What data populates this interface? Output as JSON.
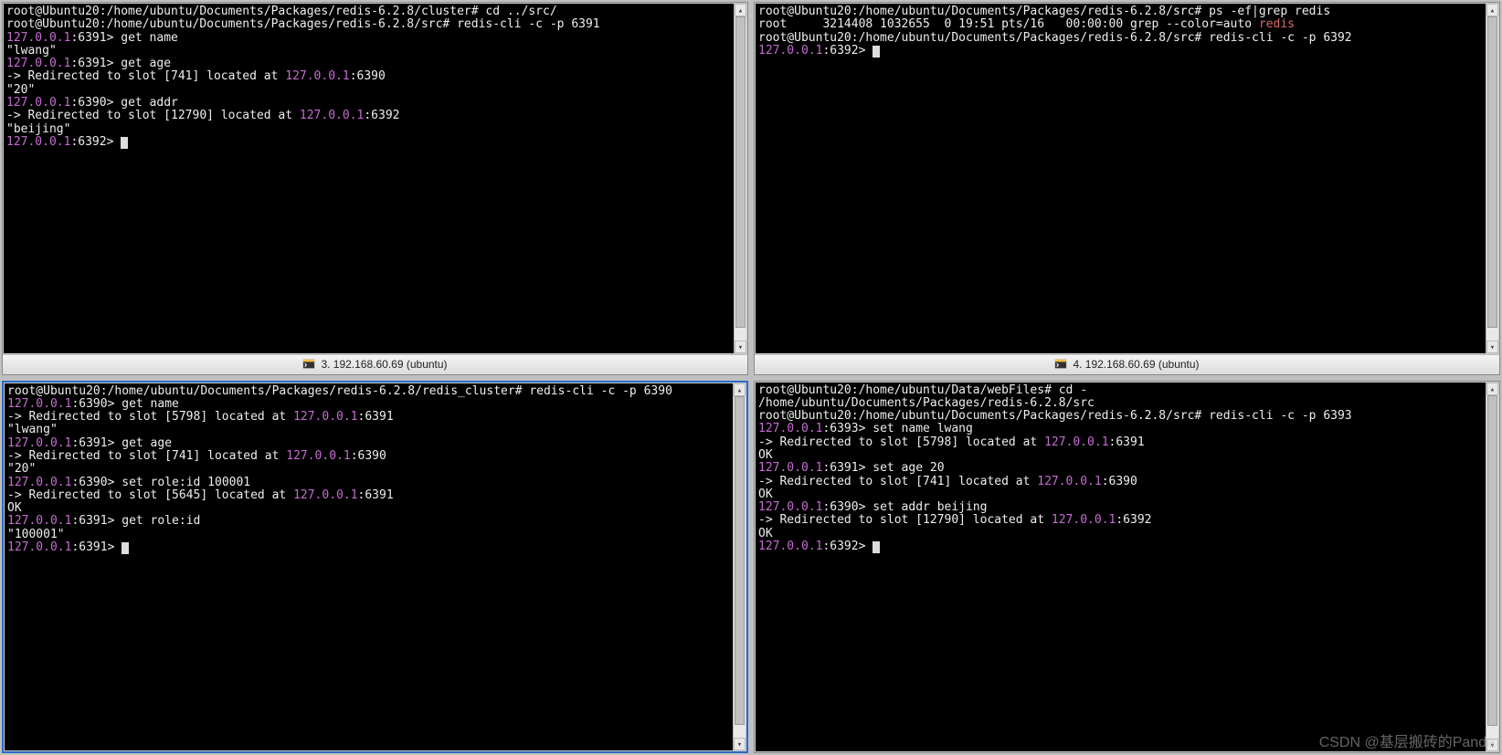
{
  "watermark": "CSDN @基层搬砖的Panda",
  "panes": {
    "top_left": {
      "tab_label": "3. 192.168.60.69 (ubuntu)",
      "lines": [
        {
          "prompt": "root@Ubuntu20:/home/ubuntu/Documents/Packages/redis-6.2.8/cluster#",
          "cmd": " cd ../src/"
        },
        {
          "prompt": "root@Ubuntu20:/home/ubuntu/Documents/Packages/redis-6.2.8/src#",
          "cmd": " redis-cli -c -p 6391"
        },
        {
          "rhost": "127.0.0.1",
          "rport": ":6391>",
          "cmd": " get name"
        },
        {
          "out": "\"lwang\""
        },
        {
          "rhost": "127.0.0.1",
          "rport": ":6391>",
          "cmd": " get age"
        },
        {
          "redir": "-> Redirected to slot [741] located at ",
          "raddr": "127.0.0.1",
          "rrest": ":6390"
        },
        {
          "out": "\"20\""
        },
        {
          "rhost": "127.0.0.1",
          "rport": ":6390>",
          "cmd": " get addr"
        },
        {
          "redir": "-> Redirected to slot [12790] located at ",
          "raddr": "127.0.0.1",
          "rrest": ":6392"
        },
        {
          "out": "\"beijing\""
        },
        {
          "rhost": "127.0.0.1",
          "rport": ":6392>",
          "cmd": " ",
          "cursor": true
        }
      ]
    },
    "top_right": {
      "tab_label": "4. 192.168.60.69 (ubuntu)",
      "lines": [
        {
          "prompt": "root@Ubuntu20:/home/ubuntu/Documents/Packages/redis-6.2.8/src#",
          "cmd": " ps -ef|grep redis"
        },
        {
          "ps": "root     3214408 1032655  0 19:51 pts/16   00:00:00 grep --color=auto ",
          "psred": "redis"
        },
        {
          "prompt": "root@Ubuntu20:/home/ubuntu/Documents/Packages/redis-6.2.8/src#",
          "cmd": " redis-cli -c -p 6392"
        },
        {
          "rhost": "127.0.0.1",
          "rport": ":6392>",
          "cmd": " ",
          "cursor": true
        }
      ]
    },
    "bottom_left": {
      "lines": [
        {
          "prompt": "root@Ubuntu20:/home/ubuntu/Documents/Packages/redis-6.2.8/redis_cluster#",
          "cmd": " redis-cli -c -p 6390"
        },
        {
          "rhost": "127.0.0.1",
          "rport": ":6390>",
          "cmd": " get name"
        },
        {
          "redir": "-> Redirected to slot [5798] located at ",
          "raddr": "127.0.0.1",
          "rrest": ":6391"
        },
        {
          "out": "\"lwang\""
        },
        {
          "rhost": "127.0.0.1",
          "rport": ":6391>",
          "cmd": " get age"
        },
        {
          "redir": "-> Redirected to slot [741] located at ",
          "raddr": "127.0.0.1",
          "rrest": ":6390"
        },
        {
          "out": "\"20\""
        },
        {
          "rhost": "127.0.0.1",
          "rport": ":6390>",
          "cmd": " set role:id 100001"
        },
        {
          "redir": "-> Redirected to slot [5645] located at ",
          "raddr": "127.0.0.1",
          "rrest": ":6391"
        },
        {
          "out": "OK"
        },
        {
          "rhost": "127.0.0.1",
          "rport": ":6391>",
          "cmd": " get role:id"
        },
        {
          "out": "\"100001\""
        },
        {
          "rhost": "127.0.0.1",
          "rport": ":6391>",
          "cmd": " ",
          "cursor": true
        }
      ]
    },
    "bottom_right": {
      "lines": [
        {
          "prompt": "root@Ubuntu20:/home/ubuntu/Data/webFiles#",
          "cmd": " cd -"
        },
        {
          "out": "/home/ubuntu/Documents/Packages/redis-6.2.8/src"
        },
        {
          "prompt": "root@Ubuntu20:/home/ubuntu/Documents/Packages/redis-6.2.8/src#",
          "cmd": " redis-cli -c -p 6393"
        },
        {
          "rhost": "127.0.0.1",
          "rport": ":6393>",
          "cmd": " set name lwang"
        },
        {
          "redir": "-> Redirected to slot [5798] located at ",
          "raddr": "127.0.0.1",
          "rrest": ":6391"
        },
        {
          "out": "OK"
        },
        {
          "rhost": "127.0.0.1",
          "rport": ":6391>",
          "cmd": " set age 20"
        },
        {
          "redir": "-> Redirected to slot [741] located at ",
          "raddr": "127.0.0.1",
          "rrest": ":6390"
        },
        {
          "out": "OK"
        },
        {
          "rhost": "127.0.0.1",
          "rport": ":6390>",
          "cmd": " set addr beijing"
        },
        {
          "redir": "-> Redirected to slot [12790] located at ",
          "raddr": "127.0.0.1",
          "rrest": ":6392"
        },
        {
          "out": "OK"
        },
        {
          "rhost": "127.0.0.1",
          "rport": ":6392>",
          "cmd": " ",
          "cursor": true
        }
      ]
    }
  }
}
